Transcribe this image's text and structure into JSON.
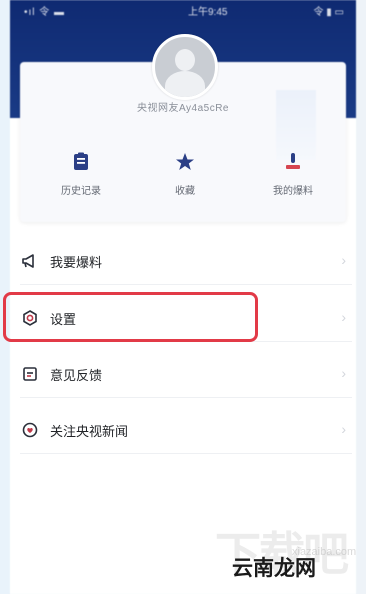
{
  "status_bar": {
    "left": "•ıl 令 ▬",
    "center": "上午9:45",
    "right": "令 ▮ ▭"
  },
  "profile": {
    "username": "央视网友Ay4a5cRe"
  },
  "shortcuts": [
    {
      "label": "历史记录",
      "icon": "history-icon"
    },
    {
      "label": "收藏",
      "icon": "star-icon"
    },
    {
      "label": "我的爆料",
      "icon": "report-icon"
    }
  ],
  "menu": [
    {
      "label": "我要爆料",
      "icon": "megaphone-icon"
    },
    {
      "label": "设置",
      "icon": "settings-icon"
    },
    {
      "label": "意见反馈",
      "icon": "feedback-icon"
    },
    {
      "label": "关注央视新闻",
      "icon": "follow-icon"
    }
  ],
  "chevron": "›",
  "watermark": {
    "big": "下载吧",
    "url": "xiazaiba.com",
    "brand": "云南龙网"
  },
  "colors": {
    "header": "#0f2a72",
    "highlight": "#e23a47"
  }
}
